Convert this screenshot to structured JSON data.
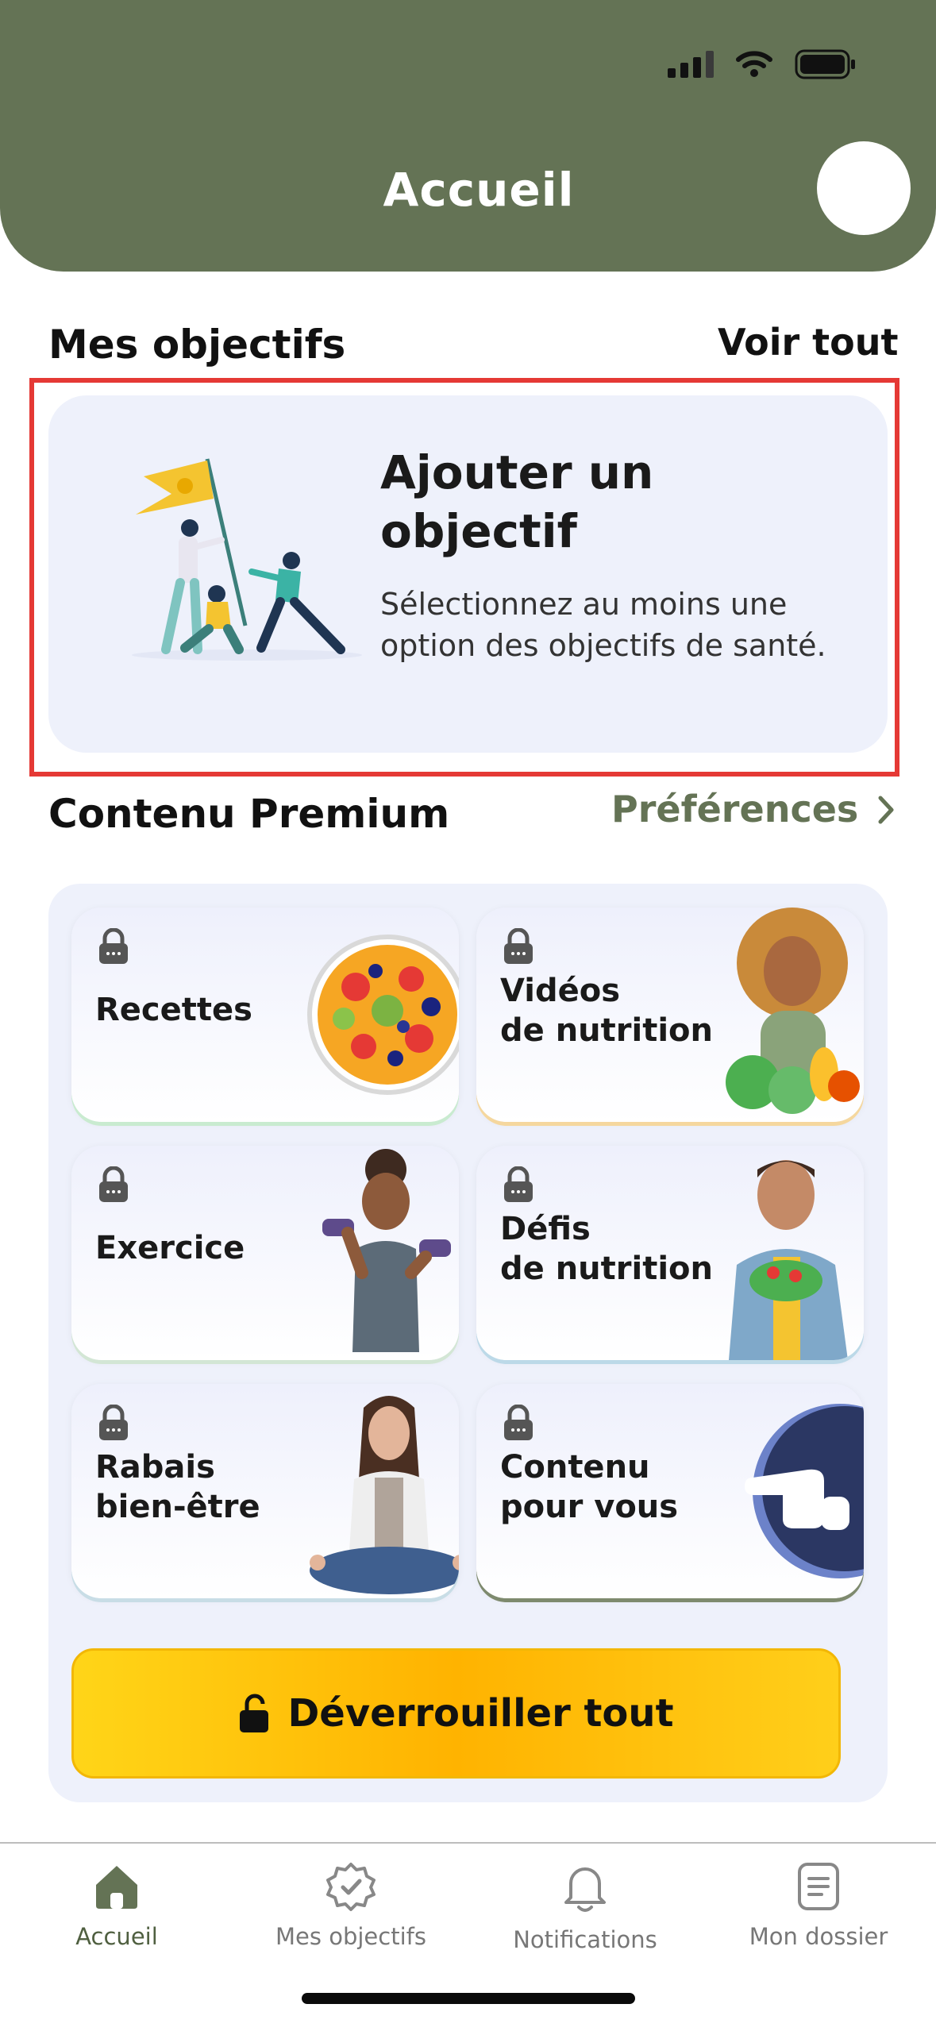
{
  "header": {
    "title": "Accueil"
  },
  "goals": {
    "section_title": "Mes objectifs",
    "see_all": "Voir tout",
    "card_title": "Ajouter un objectif",
    "card_subtitle": "Sélectionnez au moins une option des objectifs de santé."
  },
  "premium": {
    "section_title": "Contenu Premium",
    "preferences_link": "Préférences",
    "tiles": [
      {
        "line1": "Recettes",
        "line2": "",
        "icon": "fruit-bowl"
      },
      {
        "line1": "Vidéos",
        "line2": "de nutrition",
        "icon": "woman-with-vegetables"
      },
      {
        "line1": "Exercice",
        "line2": "",
        "icon": "woman-with-dumbbells"
      },
      {
        "line1": "Défis",
        "line2": "de nutrition",
        "icon": "man-with-salad"
      },
      {
        "line1": "Rabais",
        "line2": "bien-être",
        "icon": "woman-meditating"
      },
      {
        "line1": "Contenu",
        "line2": "pour vous",
        "icon": "pointing-hand"
      }
    ],
    "unlock_button": "Déverrouiller tout"
  },
  "tabbar": {
    "items": [
      {
        "label": "Accueil",
        "icon": "home-icon",
        "active": true
      },
      {
        "label": "Mes objectifs",
        "icon": "badge-check-icon",
        "active": false
      },
      {
        "label": "Notifications",
        "icon": "bell-icon",
        "active": false
      },
      {
        "label": "Mon dossier",
        "icon": "document-icon",
        "active": false
      }
    ]
  },
  "colors": {
    "header": "#647355",
    "accent_green": "#647355",
    "highlight_border": "#e53935",
    "unlock_gold": "#ffb300"
  }
}
